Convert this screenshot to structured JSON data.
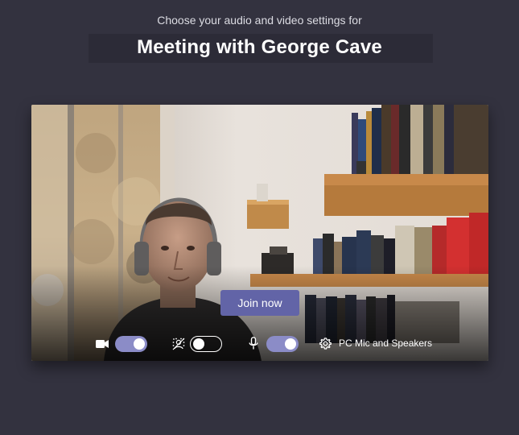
{
  "header": {
    "subtitle": "Choose your audio and video settings for",
    "meeting_title": "Meeting with George Cave"
  },
  "preview": {
    "join_label": "Join now"
  },
  "controls": {
    "camera_on": true,
    "background_blur_on": false,
    "microphone_on": true,
    "device_label": "PC Mic and Speakers"
  },
  "colors": {
    "background": "#33323f",
    "accent": "#6264a7",
    "toggle_on": "#8b8cc7"
  }
}
